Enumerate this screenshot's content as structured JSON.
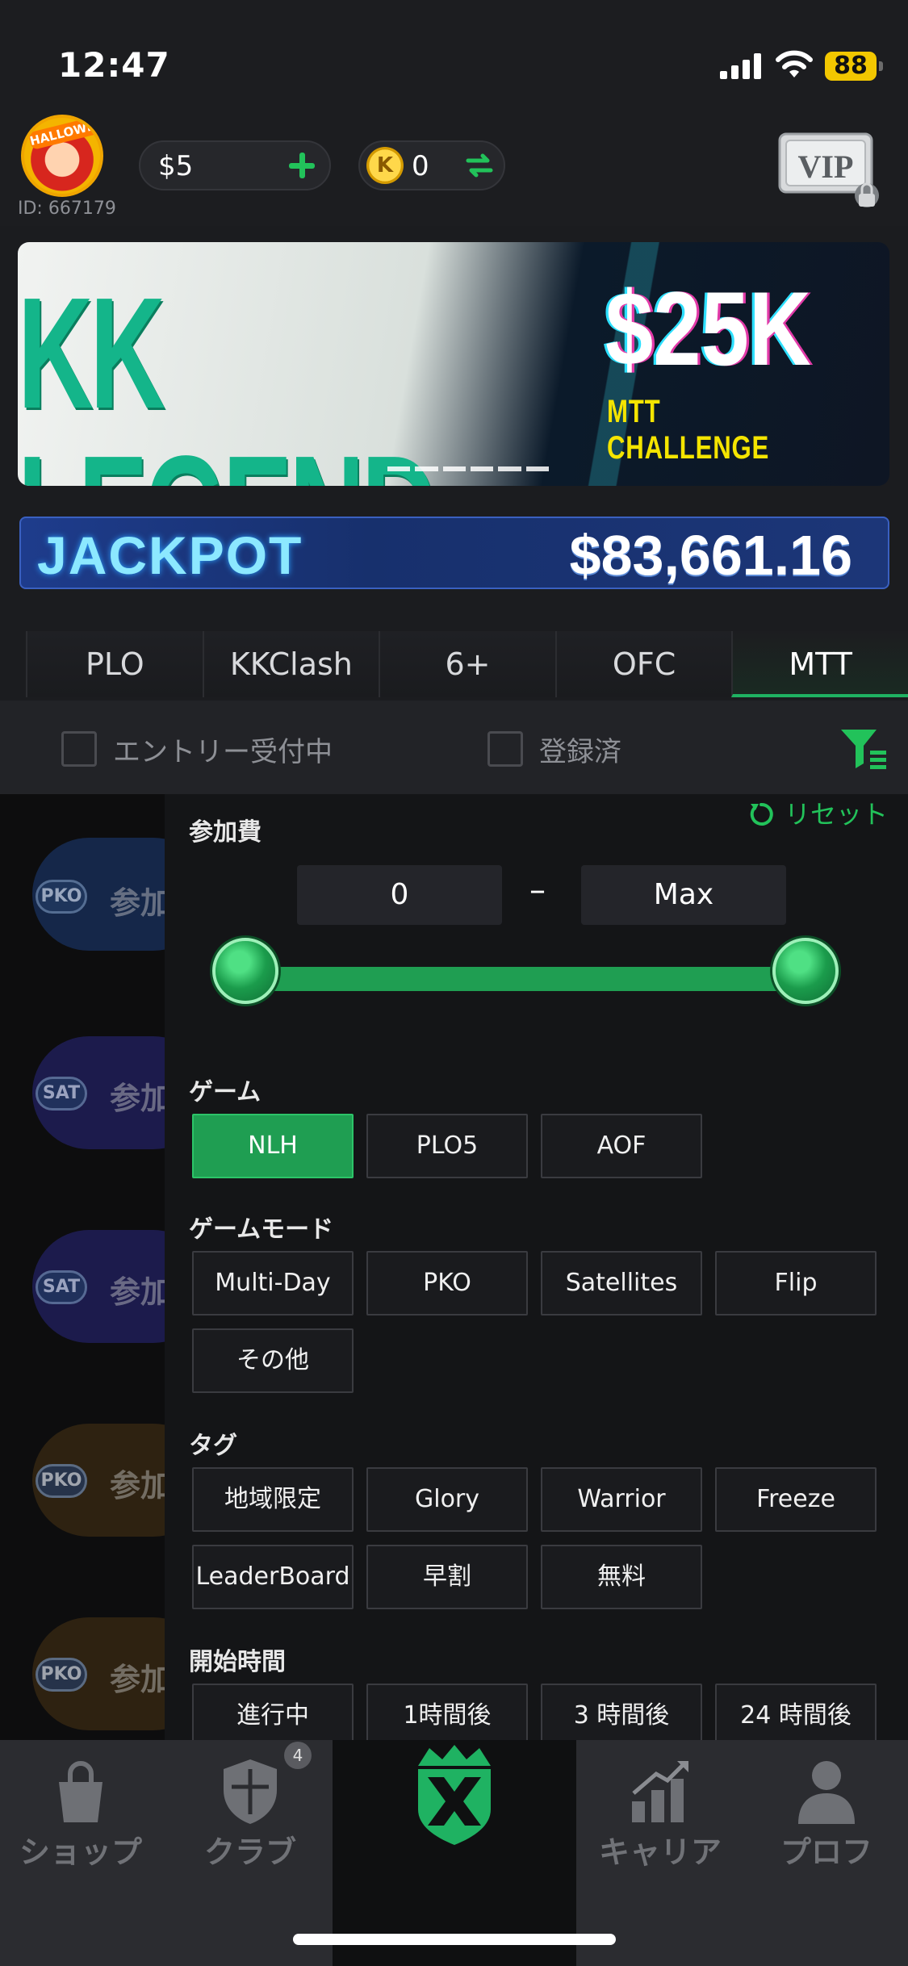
{
  "status_bar": {
    "time": "12:47",
    "battery": "88"
  },
  "header": {
    "avatar_tag": "HALLOWEEN",
    "user_id": "ID: 667179",
    "cash": "$5",
    "coins": "0",
    "coin_symbol": "K",
    "vip_label": "VIP"
  },
  "banner": {
    "title": "KK LEGEND",
    "amount": "$25K",
    "subtitle": "MTT CHALLENGE"
  },
  "jackpot": {
    "label": "JACKPOT",
    "amount": "$83,661.16"
  },
  "tabs": [
    {
      "label": "PLO"
    },
    {
      "label": "KKClash"
    },
    {
      "label": "6+"
    },
    {
      "label": "OFC"
    },
    {
      "label": "MTT",
      "active": true
    }
  ],
  "filters": {
    "entry_open": "エントリー受付中",
    "registered": "登録済"
  },
  "list_bg": {
    "badges": [
      "PKO",
      "SAT",
      "SAT",
      "PKO",
      "PKO"
    ],
    "join_text": "参加"
  },
  "panel": {
    "reset": "リセット",
    "entry_fee": {
      "label": "参加費",
      "min": "0",
      "max": "Max",
      "dash": "–",
      "range": [
        0.0,
        1.0
      ]
    },
    "game": {
      "label": "ゲーム",
      "options": [
        {
          "label": "NLH",
          "selected": true
        },
        {
          "label": "PLO5",
          "selected": false
        },
        {
          "label": "AOF",
          "selected": false
        }
      ]
    },
    "game_mode": {
      "label": "ゲームモード",
      "options": [
        "Multi-Day",
        "PKO",
        "Satellites",
        "Flip",
        "その他"
      ]
    },
    "tags": {
      "label": "タグ",
      "options": [
        "地域限定",
        "Glory",
        "Warrior",
        "Freeze",
        "LeaderBoard",
        "早割",
        "無料"
      ]
    },
    "start_time": {
      "label": "開始時間",
      "options": [
        "進行中",
        "1時間後",
        "3 時間後",
        "24 時間後"
      ]
    }
  },
  "bottom_nav": {
    "shop": "ショップ",
    "club": "クラブ",
    "club_badge": "4",
    "career": "キャリア",
    "profile": "プロフ"
  },
  "colors": {
    "accent": "#1f9e52",
    "background": "#1b1c1f"
  }
}
